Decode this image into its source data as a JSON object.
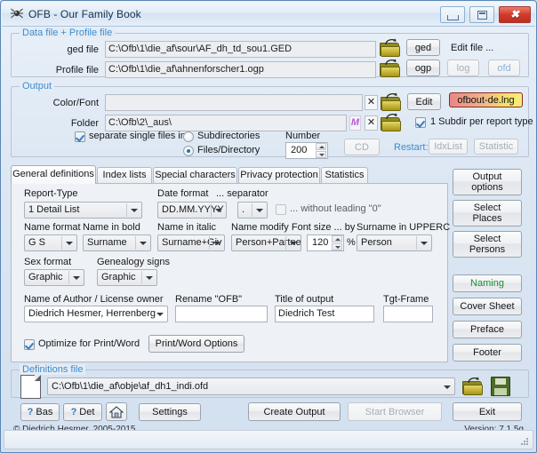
{
  "window": {
    "title": "OFB - Our Family Book",
    "icon": "app-spider-icon",
    "minimize": "",
    "maximize": "",
    "close": "✖"
  },
  "data_profile_group": {
    "title": "Data file + Profile file",
    "ged_label": "ged file",
    "ged_value": "C:\\Ofb\\1\\die_af\\sour\\AF_dh_td_sou1.GED",
    "ged_button": "ged",
    "edit_file_label": "Edit file ...",
    "profile_label": "Profile file",
    "profile_value": "C:\\Ofb\\1\\die_af\\ahnenforscher1.ogp",
    "profile_button": "ogp",
    "log_button": "log",
    "ofd_button": "ofd"
  },
  "output_group": {
    "title": "Output",
    "colorfont_label": "Color/Font",
    "colorfont_value": "",
    "clear_icon": "✕",
    "edit_button": "Edit",
    "lng_button": "ofbout-de.lng",
    "folder_label": "Folder",
    "folder_value": "C:\\Ofb\\2\\_aus\\",
    "m_icon": "M",
    "subdir_checkbox_label": "1 Subdir per report type",
    "subdir_checkbox_checked": true,
    "separate_label": "separate single files into",
    "separate_checked": true,
    "radio_subdirectories": "Subdirectories",
    "radio_files_directory": "Files/Directory",
    "radio_selected": "Files/Directory",
    "number_label": "Number",
    "number_value": "200",
    "cd_button": "CD",
    "restart_label": "Restart:",
    "idxlist_button": "IdxList",
    "statistic_button": "Statistic"
  },
  "tabs": [
    {
      "label": "General definitions",
      "active": true
    },
    {
      "label": "Index lists",
      "active": false
    },
    {
      "label": "Special characters",
      "active": false
    },
    {
      "label": "Privacy protection",
      "active": false
    },
    {
      "label": "Statistics",
      "active": false
    }
  ],
  "general": {
    "report_type_label": "Report-Type",
    "report_type_value": "1 Detail List",
    "date_format_label": "Date format",
    "date_format_value": "DD.MM.YYYY",
    "separator_label": "... separator",
    "separator_value": ".",
    "without_leading_zero_label": "... without leading \"0\"",
    "without_leading_zero_checked": false,
    "name_format_label": "Name format",
    "name_format_value": "G S",
    "name_bold_label": "Name in bold",
    "name_bold_value": "Surname",
    "name_italic_label": "Name in italic",
    "name_italic_value": "Surname+Giv",
    "name_modify_label": "Name modify Font size ... by",
    "name_modify_value": "Person+Partner",
    "font_size_value": "120",
    "percent_label": "%",
    "surname_upper_label": "Surname in UPPERC",
    "surname_upper_value": "Person",
    "sex_format_label": "Sex format",
    "sex_format_value": "Graphic",
    "genealogy_signs_label": "Genealogy signs",
    "genealogy_signs_value": "Graphic",
    "author_label": "Name of Author / License owner",
    "author_value": "Diedrich Hesmer, Herrenberg",
    "rename_label": "Rename \"OFB\"",
    "rename_value": "",
    "title_output_label": "Title of output",
    "title_output_value": "Diedrich Test",
    "tgt_frame_label": "Tgt-Frame",
    "tgt_frame_value": "",
    "optimize_label": "Optimize for Print/Word",
    "optimize_checked": true,
    "print_word_options_button": "Print/Word Options"
  },
  "side_buttons": [
    {
      "label": "Output\noptions",
      "name": "output-options-button",
      "style": "normal"
    },
    {
      "label": "Select\nPlaces",
      "name": "select-places-button",
      "style": "normal"
    },
    {
      "label": "Select\nPersons",
      "name": "select-persons-button",
      "style": "normal"
    },
    {
      "label": "Naming",
      "name": "naming-button",
      "style": "green"
    },
    {
      "label": "Cover Sheet",
      "name": "cover-sheet-button",
      "style": "normal"
    },
    {
      "label": "Preface",
      "name": "preface-button",
      "style": "normal"
    },
    {
      "label": "Footer",
      "name": "footer-button",
      "style": "normal"
    }
  ],
  "definitions_group": {
    "title": "Definitions file",
    "value": "C:\\Ofb\\1\\die_af\\obje\\af_dh1_indi.ofd"
  },
  "bottom": {
    "bas_button": "Bas",
    "det_button": "Det",
    "question_mark": "?",
    "settings_button": "Settings",
    "create_output_button": "Create Output",
    "start_browser_button": "Start Browser",
    "exit_button": "Exit",
    "copyright": "© Diedrich Hesmer, 2005-2015",
    "version": "Version: 7.1.5g"
  },
  "colors": {
    "group_title": "#3f8ccc",
    "accent_green": "#1f8b2e",
    "close_red": "#d33a2b"
  }
}
